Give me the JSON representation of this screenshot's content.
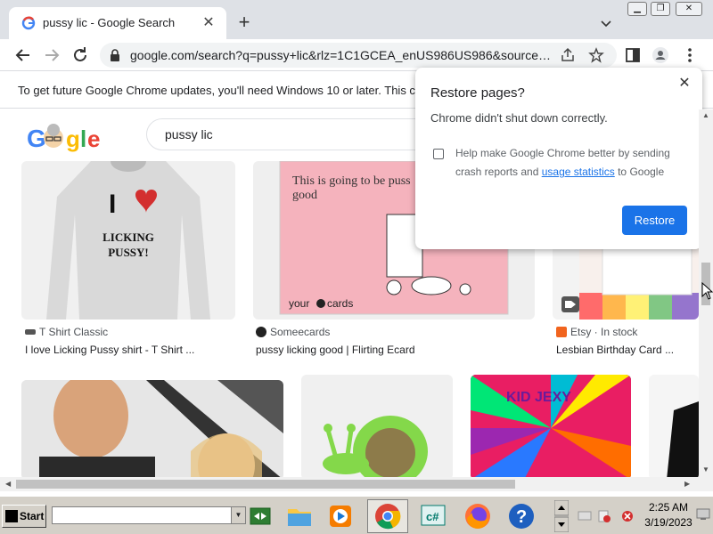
{
  "browser": {
    "tab_title": "pussy lic - Google Search",
    "url": "google.com/search?q=pussy+lic&rlz=1C1GCEA_enUS986US986&source=l...",
    "infobar_text": "To get future Google Chrome updates, you'll need Windows 10 or later. This co"
  },
  "search": {
    "query": "pussy lic",
    "logo_text": "Google"
  },
  "results": {
    "row1": [
      {
        "source": "T Shirt Classic",
        "caption": "I love Licking Pussy shirt - T Shirt ...",
        "image_text": [
          "I",
          "LICKING",
          "PUSSY!"
        ]
      },
      {
        "source": "Someecards",
        "caption": "pussy licking good | Flirting Ecard",
        "image_text": [
          "This is going to be puss",
          "good",
          "your",
          "cards"
        ]
      },
      {
        "source": "Etsy · In stock",
        "caption": "Lesbian Birthday Card ..."
      }
    ],
    "row2_tile_text": "KID JEXY"
  },
  "dialog": {
    "title": "Restore pages?",
    "message": "Chrome didn't shut down correctly.",
    "checkbox_line1": "Help make Google Chrome better by sending",
    "checkbox_prefix": "crash reports and ",
    "checkbox_link": "usage statistics",
    "checkbox_suffix": " to Google",
    "button": "Restore"
  },
  "taskbar": {
    "start_label": "Start",
    "time": "2:25 AM",
    "date": "3/19/2023"
  },
  "colors": {
    "accent": "#1a73e8",
    "tabstrip": "#dee1e6",
    "taskbar": "#d4d0c8"
  }
}
